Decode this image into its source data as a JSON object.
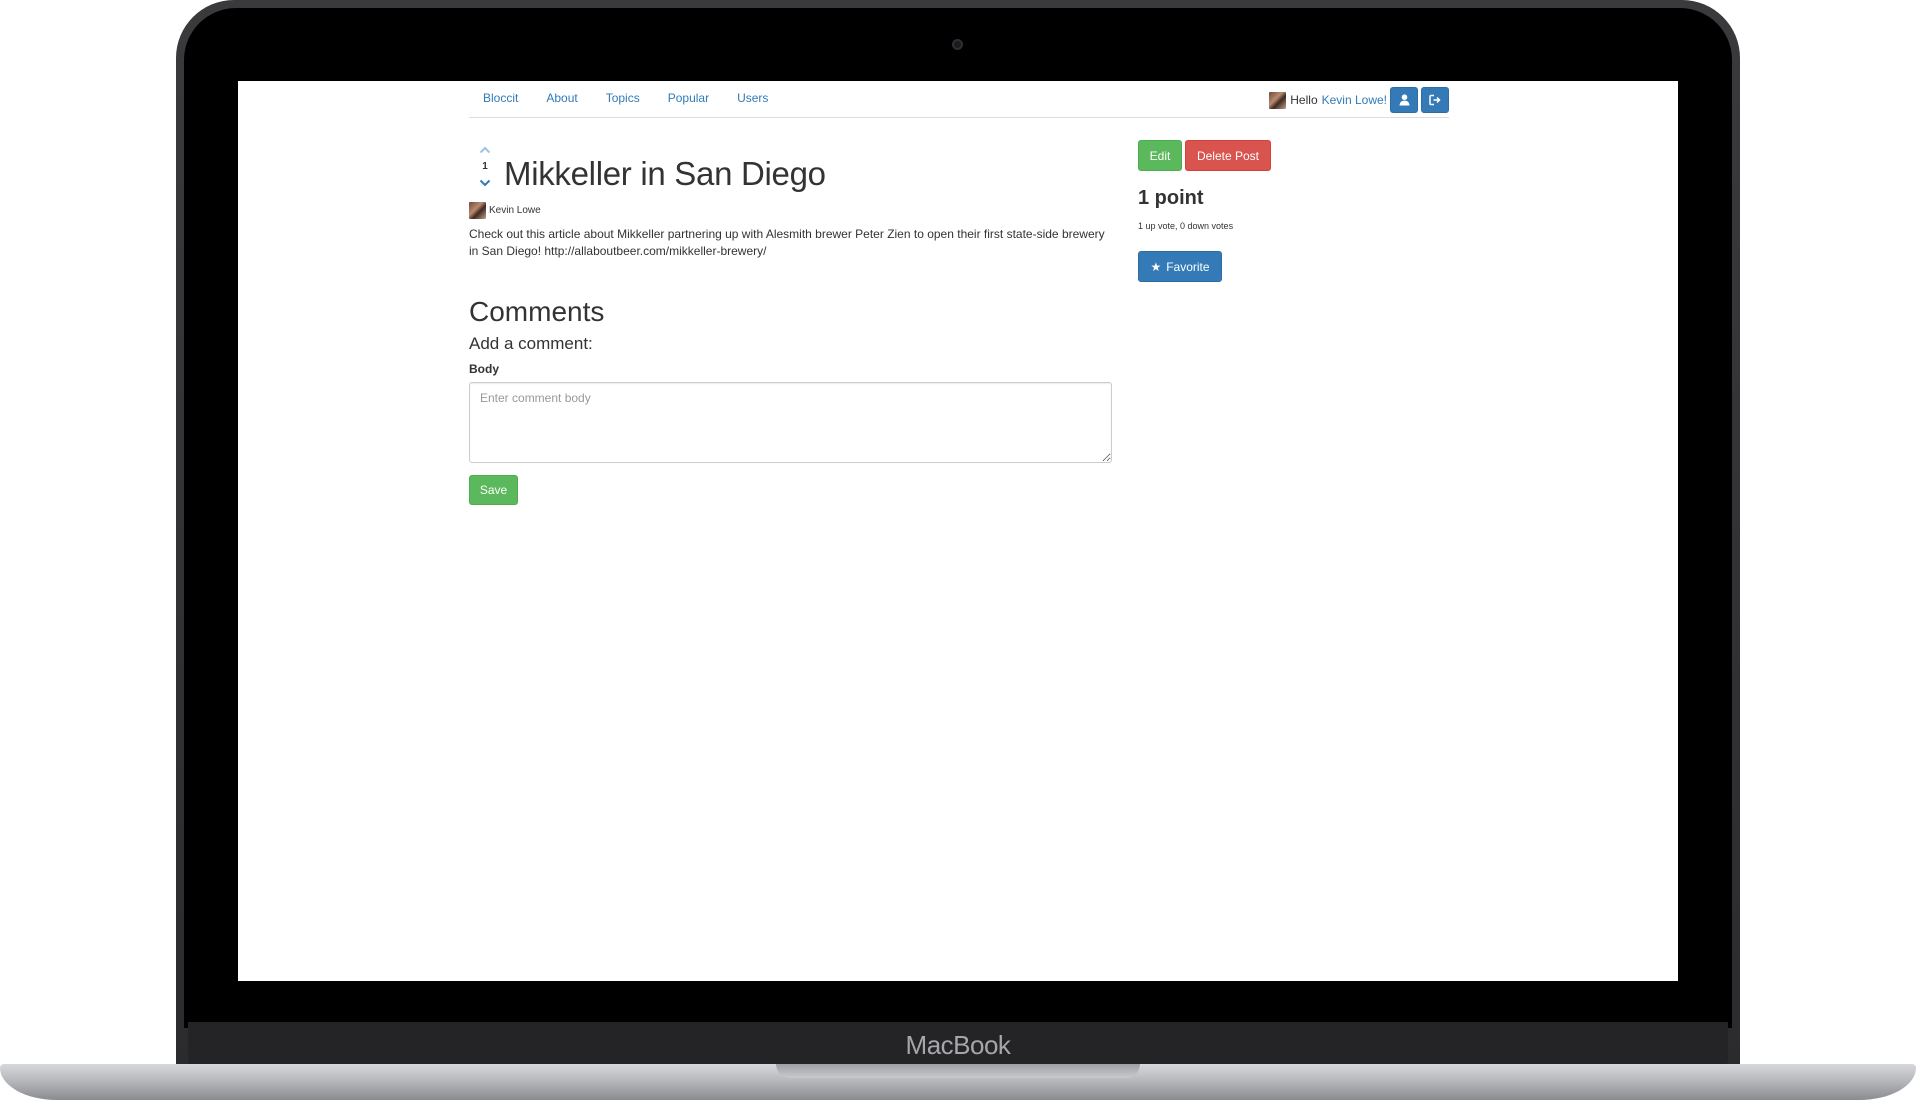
{
  "device": {
    "brand": "MacBook"
  },
  "nav": {
    "links": [
      "Bloccit",
      "About",
      "Topics",
      "Popular",
      "Users"
    ],
    "greeting": "Hello",
    "user_name": "Kevin Lowe!",
    "profile_icon": "user-icon",
    "logout_icon": "sign-out-icon"
  },
  "post": {
    "vote_count": "1",
    "title": "Mikkeller in San Diego",
    "author": "Kevin Lowe",
    "body": "Check out this article about Mikkeller partnering up with Alesmith brewer Peter Zien to open their first state-side brewery in San Diego! http://allaboutbeer.com/mikkeller-brewery/"
  },
  "sidebar": {
    "edit_label": "Edit",
    "delete_label": "Delete Post",
    "points": "1 point",
    "votes_summary": "1 up vote, 0 down votes",
    "favorite_label": "Favorite"
  },
  "comments": {
    "heading": "Comments",
    "add_heading": "Add a comment:",
    "body_label": "Body",
    "placeholder": "Enter comment body",
    "value": "",
    "save_label": "Save"
  },
  "colors": {
    "primary": "#337ab7",
    "success": "#5cb85c",
    "danger": "#d9534f"
  }
}
